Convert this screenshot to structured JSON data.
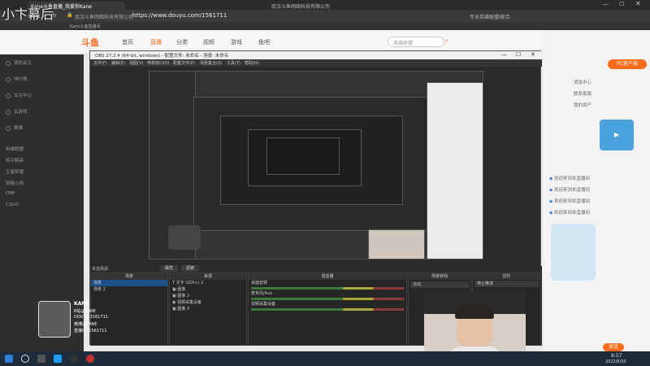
{
  "watermark": "小卞幕后",
  "browser": {
    "tabs": [
      "Kane斗鱼直播_我爱你Kane",
      "武汉斗鱼网络科技有限公司",
      "Kane斗鱼直播间_游戏"
    ],
    "url": "https://www.douyu.com/1561711",
    "url_prefix": "武汉斗鱼网络科技有限公司",
    "search_hint": "专业英雄联盟Ⅰ联合",
    "bookmark": "Kane斗鱼直播间"
  },
  "douyu": {
    "logo": "斗鱼",
    "nav": [
      "首页",
      "直播",
      "分类",
      "视频",
      "游戏",
      "鱼吧"
    ],
    "search_placeholder": "英雄联盟",
    "sidebar": [
      "我的关注",
      "排行榜",
      "关注中心",
      "云游戏",
      "赛事"
    ],
    "sidebar_tags": [
      "英雄联盟",
      "和平精英",
      "王者荣耀",
      "穿越火线",
      "DNF",
      "CSGO"
    ],
    "pc_client": "PC客户端",
    "right_links": [
      "消息中心",
      "联系客服",
      "我的资产"
    ],
    "chat": [
      "欢迎来到本直播间",
      "欢迎来到本直播间",
      "欢迎来到本直播间",
      "欢迎来到本直播间"
    ],
    "send_button": "发送"
  },
  "obs": {
    "title": "OBS 27.2.4 (64-bit, windows) - 配置文件: 未命名 - 场景: 未命名",
    "menu": [
      "文件(F)",
      "编辑(E)",
      "视图(V)",
      "停靠窗口(D)",
      "配置文件(P)",
      "场景集合(S)",
      "工具(T)",
      "帮助(H)"
    ],
    "properties_label": "未选择源",
    "properties_button": "属性",
    "filters_button": "滤镜",
    "docks": {
      "scenes": {
        "title": "场景",
        "items": [
          "场景",
          "场景 2"
        ]
      },
      "sources": {
        "title": "来源",
        "items": [
          "文字 (GDI+) 2",
          "图像",
          "图像 2",
          "视频采集设备",
          "图像 3"
        ]
      },
      "mixer": {
        "title": "混音器",
        "channels": [
          "桌面音频",
          "麦克风/Aux",
          "视频采集设备"
        ]
      },
      "transitions": {
        "title": "场景转场",
        "selected": "淡出"
      },
      "controls": {
        "title": "控件",
        "buttons": [
          "停止推流",
          "开始录制",
          "启动虚拟摄像机",
          "工作室模式",
          "设置",
          "退出"
        ]
      }
    },
    "status": "LIVE: 00:00:00  REC: 00:00:00  CPU: 3.5%"
  },
  "streamer_card": {
    "name": "KANE",
    "lines": [
      "B站@KANE",
      "DOUYU 1561711",
      "微博@KANE",
      "直播间: 1561711"
    ]
  },
  "taskbar": {
    "clock": "8:57",
    "date": "2022/6/30"
  },
  "colors": {
    "accent": "#ff6b1a",
    "obs_bg": "#2a2a2a",
    "taskbar": "#1d2b3a"
  }
}
